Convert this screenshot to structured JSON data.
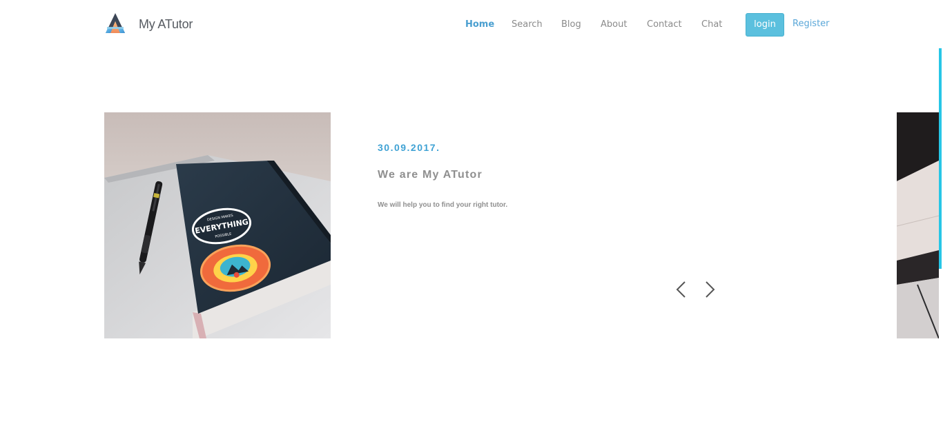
{
  "brand": {
    "name": "My ATutor",
    "icon": "a-logo-icon"
  },
  "nav": {
    "items": [
      {
        "label": "Home",
        "active": true
      },
      {
        "label": "Search",
        "active": false
      },
      {
        "label": "Blog",
        "active": false
      },
      {
        "label": "About",
        "active": false
      },
      {
        "label": "Contact",
        "active": false
      },
      {
        "label": "Chat",
        "active": false
      }
    ],
    "login_label": "login",
    "register_label": "Register"
  },
  "slide": {
    "date": "30.09.2017.",
    "title": "We are My ATutor",
    "description": "We will help you to find your right tutor.",
    "image": "notebook-with-pen-photo",
    "prev_icon": "chevron-left-icon",
    "next_icon": "chevron-right-icon"
  },
  "colors": {
    "accent": "#3fa2d4",
    "login_button": "#5bc0de",
    "scroll_accent": "#27c6e6",
    "muted_text": "#8f8f8f"
  }
}
